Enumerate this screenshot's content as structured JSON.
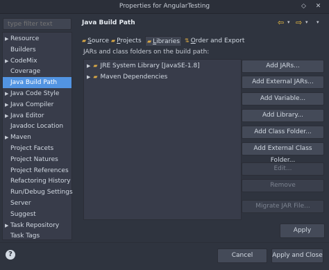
{
  "window": {
    "title": "Properties for AngularTesting",
    "restore_glyph": "◇",
    "close_glyph": "✕"
  },
  "filter": {
    "placeholder": "type filter text"
  },
  "tree": {
    "items": [
      {
        "label": "Resource",
        "expandable": true
      },
      {
        "label": "Builders",
        "expandable": false
      },
      {
        "label": "CodeMix",
        "expandable": true
      },
      {
        "label": "Coverage",
        "expandable": false
      },
      {
        "label": "Java Build Path",
        "expandable": false,
        "selected": true
      },
      {
        "label": "Java Code Style",
        "expandable": true
      },
      {
        "label": "Java Compiler",
        "expandable": true
      },
      {
        "label": "Java Editor",
        "expandable": true
      },
      {
        "label": "Javadoc Location",
        "expandable": false
      },
      {
        "label": "Maven",
        "expandable": true
      },
      {
        "label": "Project Facets",
        "expandable": false
      },
      {
        "label": "Project Natures",
        "expandable": false
      },
      {
        "label": "Project References",
        "expandable": false
      },
      {
        "label": "Refactoring History",
        "expandable": false
      },
      {
        "label": "Run/Debug Settings",
        "expandable": false
      },
      {
        "label": "Server",
        "expandable": false
      },
      {
        "label": "Suggest",
        "expandable": false
      },
      {
        "label": "Task Repository",
        "expandable": true
      },
      {
        "label": "Task Tags",
        "expandable": false
      }
    ]
  },
  "page": {
    "title": "Java Build Path",
    "back_glyph": "⇦",
    "forward_glyph": "⇨",
    "drop_glyph": "▾",
    "tabs": [
      {
        "label": "Source",
        "mnemonic": "S",
        "rest": "ource",
        "icon": "▰"
      },
      {
        "label": "Projects",
        "mnemonic": "P",
        "rest": "rojects",
        "icon": "▰"
      },
      {
        "label": "Libraries",
        "mnemonic": "L",
        "rest": "ibraries",
        "icon": "▰",
        "active": true
      },
      {
        "label": "Order and Export",
        "mnemonic": "O",
        "rest": "rder and Export",
        "icon": "⇅"
      }
    ],
    "description": "JARs and class folders on the build path:",
    "libraries": [
      {
        "label": "JRE System Library [JavaSE-1.8]"
      },
      {
        "label": "Maven Dependencies"
      }
    ],
    "buttons": [
      {
        "label": "Add JARs...",
        "enabled": true
      },
      {
        "label": "Add External JARs...",
        "enabled": true
      },
      {
        "label": "Add Variable...",
        "enabled": true
      },
      {
        "label": "Add Library...",
        "enabled": true
      },
      {
        "label": "Add Class Folder...",
        "enabled": true
      },
      {
        "label": "Add External Class Folder...",
        "enabled": true
      },
      {
        "label": "Edit...",
        "enabled": false
      },
      {
        "label": "Remove",
        "enabled": false
      },
      {
        "label": "Migrate JAR File...",
        "enabled": false
      }
    ],
    "apply_label": "Apply"
  },
  "footer": {
    "help_glyph": "?",
    "cancel_label": "Cancel",
    "apply_close_label": "Apply and Close"
  },
  "colors": {
    "background": "#2f343f",
    "selection": "#5294e2",
    "field": "#383c4a",
    "icon_accent": "#f0c040"
  }
}
